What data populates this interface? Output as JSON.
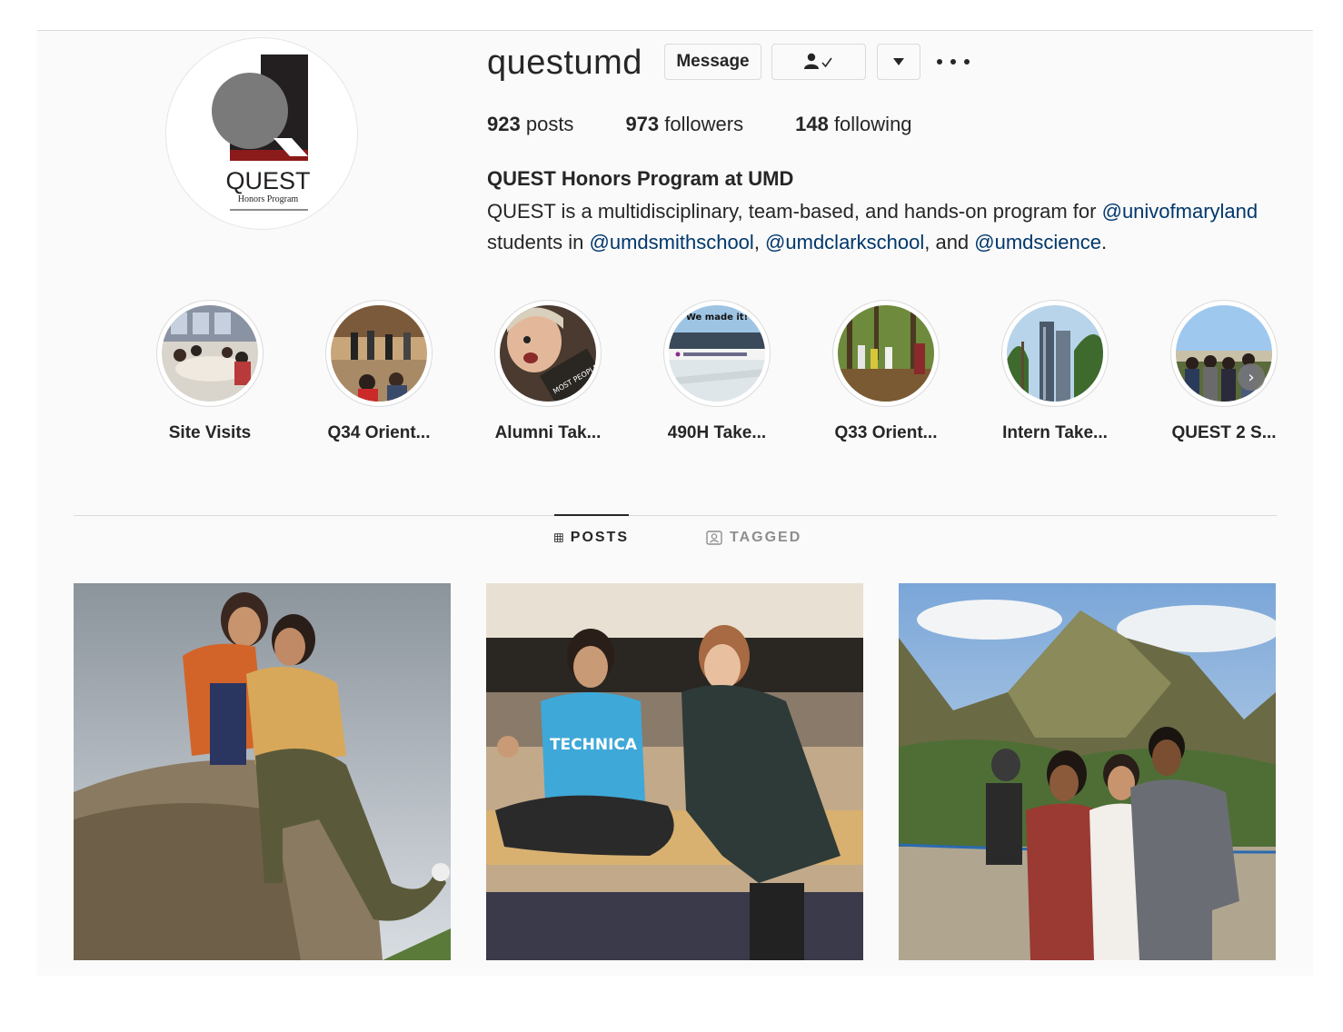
{
  "profile": {
    "username": "questumd",
    "message_label": "Message",
    "posts_count": "923",
    "posts_label": "posts",
    "followers_count": "973",
    "followers_label": "followers",
    "following_count": "148",
    "following_label": "following",
    "full_name": "QUEST Honors Program at UMD",
    "bio_text_1": "QUEST is a multidisciplinary, team-based, and hands-on program for ",
    "bio_mention_1": "@univofmaryland",
    "bio_text_2": "students in ",
    "bio_mention_2": "@umdsmithschool",
    "bio_sep_1": ", ",
    "bio_mention_3": "@umdclarkschool",
    "bio_sep_2": ", and ",
    "bio_mention_4": "@umdscience",
    "bio_end": ".",
    "logo_text": "QUEST",
    "logo_subtext": "Honors Program"
  },
  "highlights": [
    {
      "label": "Site Visits"
    },
    {
      "label": "Q34 Orient..."
    },
    {
      "label": "Alumni Tak..."
    },
    {
      "label": "490H Take...",
      "overlay": "We made it!"
    },
    {
      "label": "Q33 Orient..."
    },
    {
      "label": "Intern Take..."
    },
    {
      "label": "QUEST 2 S..."
    }
  ],
  "tabs": {
    "posts": "POSTS",
    "tagged": "TAGGED"
  },
  "posts": [
    {
      "caption_text": ""
    },
    {
      "shirt_text": "TECHNICA"
    },
    {
      "caption_text": ""
    }
  ],
  "colors": {
    "link": "#00376b",
    "text": "#262626",
    "muted": "#8e8e8e",
    "border": "#dbdbdb",
    "logo_red": "#8b1a1a"
  }
}
